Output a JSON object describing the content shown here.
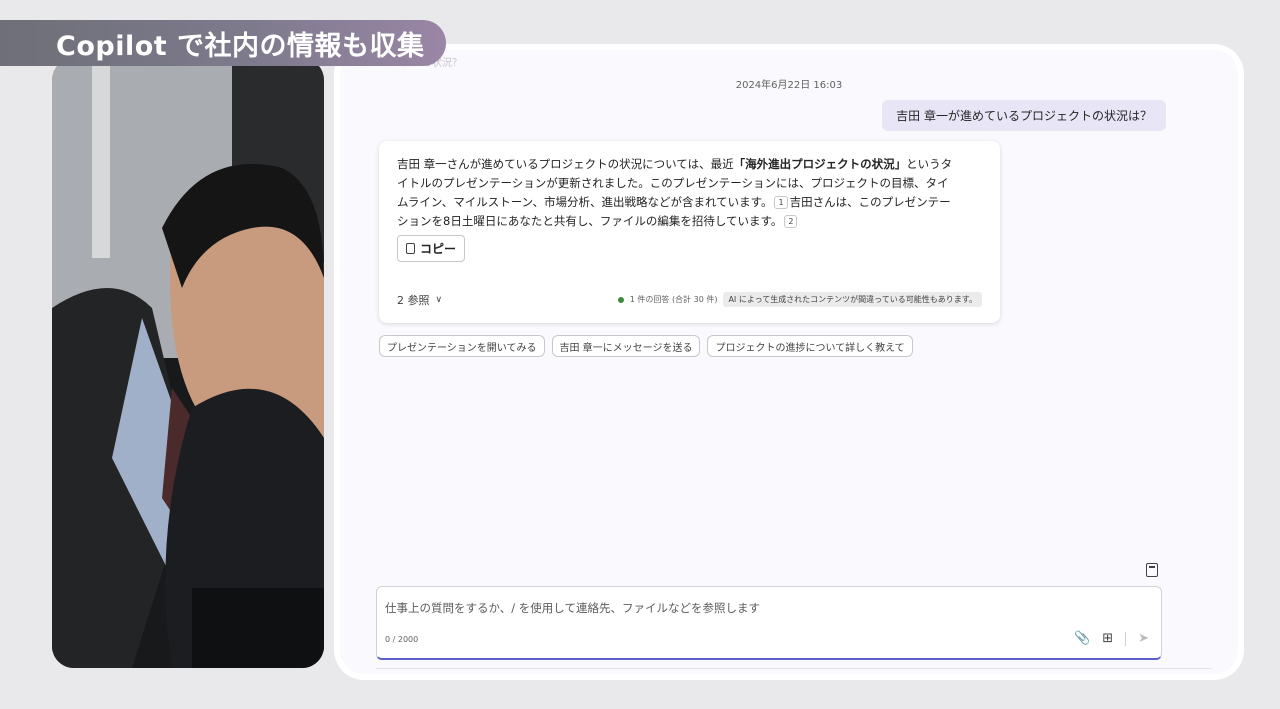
{
  "banner": {
    "title": "Copilot で社内の情報も収集"
  },
  "chat": {
    "faded_header": "プロジェクトの状況？",
    "timestamp": "2024年6月22日 16:03",
    "user_message": "吉田 章一が進めているプロジェクトの状況は？",
    "response": {
      "line1_prefix": "吉田 章一さんが進めているプロジェクトの状況については、最近",
      "line1_bold": "「海外進出プロジェクトの状況」",
      "line1_suffix": "というタ",
      "line2": "イトルのプレゼンテーションが更新されました。このプレゼンテーションには、プロジェクトの目標、タイ",
      "line3_prefix": "ムライン、マイルストーン、市場分析、進出戦略などが含まれています。",
      "cite1": "1",
      "line3_suffix": "吉田さんは、このプレゼンテー",
      "line4_prefix": "ションを8日土曜日にあなたと共有し、ファイルの編集を招待しています。",
      "cite2": "2"
    },
    "copy_label": "コピー",
    "references_label": "2 参照",
    "responses_count": "1 件の回答 (合計 30 件)",
    "ai_disclaimer": "AI によって生成されたコンテンツが間違っている可能性もあります。",
    "suggestions": [
      "プレゼンテーションを開いてみる",
      "吉田 章一にメッセージを送る",
      "プロジェクトの進捗について詳しく教えて"
    ]
  },
  "composer": {
    "placeholder": "仕事上の質問をするか、/ を使用して連絡先、ファイルなどを参照します",
    "char_count": "0 / 2000"
  },
  "colors": {
    "accent": "#5b5fc7",
    "user_bubble": "#e8e6f6",
    "status_green": "#3f8a3a"
  }
}
